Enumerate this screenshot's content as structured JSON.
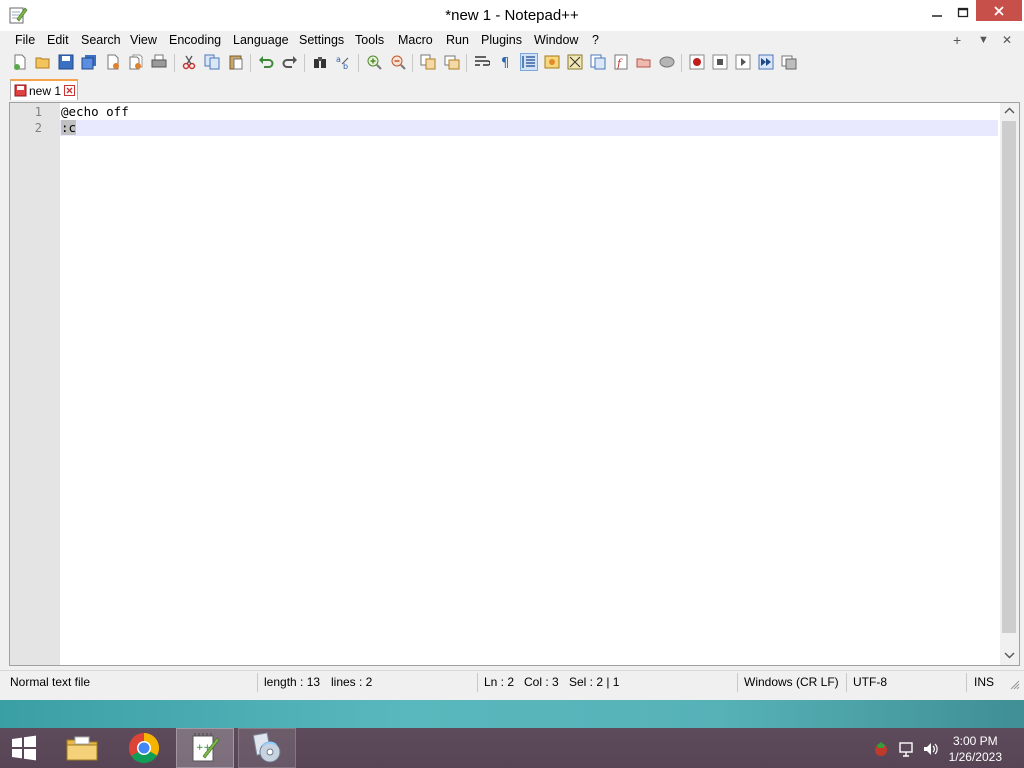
{
  "window": {
    "title": "*new 1 - Notepad++"
  },
  "menu": {
    "items": [
      {
        "id": "file",
        "label": "File"
      },
      {
        "id": "edit",
        "label": "Edit"
      },
      {
        "id": "search",
        "label": "Search"
      },
      {
        "id": "view",
        "label": "View"
      },
      {
        "id": "encoding",
        "label": "Encoding"
      },
      {
        "id": "language",
        "label": "Language"
      },
      {
        "id": "settings",
        "label": "Settings"
      },
      {
        "id": "tools",
        "label": "Tools"
      },
      {
        "id": "macro",
        "label": "Macro"
      },
      {
        "id": "run",
        "label": "Run"
      },
      {
        "id": "plugins",
        "label": "Plugins"
      },
      {
        "id": "window",
        "label": "Window"
      },
      {
        "id": "help",
        "label": "?"
      }
    ],
    "right": {
      "add": "+",
      "dropdown": "▼",
      "close": "✕"
    }
  },
  "toolbar": {
    "icons": [
      "new-file-icon",
      "open-file-icon",
      "save-icon",
      "save-all-icon",
      "close-icon",
      "close-all-icon",
      "print-icon",
      "cut-icon",
      "copy-icon",
      "paste-icon",
      "undo-icon",
      "redo-icon",
      "find-icon",
      "replace-icon",
      "zoom-in-icon",
      "zoom-out-icon",
      "sync-vertical-icon",
      "sync-horizontal-icon",
      "word-wrap-icon",
      "show-all-characters-icon",
      "indent-guide-icon",
      "user-defined-language-icon",
      "document-map-icon",
      "document-list-icon",
      "function-list-icon",
      "folder-as-workspace-icon",
      "monitoring-icon",
      "record-macro-icon",
      "stop-recording-icon",
      "playback-icon",
      "run-macro-multiple-icon",
      "save-macro-icon"
    ]
  },
  "tabs": [
    {
      "label": "new 1",
      "modified": true
    }
  ],
  "editor": {
    "lines": [
      {
        "num": "1",
        "text": "@echo off"
      },
      {
        "num": "2",
        "text": ":c"
      }
    ],
    "current_line": 2
  },
  "status": {
    "file_type": "Normal text file",
    "length": "length : 13",
    "lines": "lines : 2",
    "ln": "Ln : 2",
    "col": "Col : 3",
    "sel": "Sel : 2 | 1",
    "eol": "Windows (CR LF)",
    "encoding": "UTF-8",
    "mode": "INS"
  },
  "taskbar": {
    "apps": [
      {
        "name": "file-explorer-icon"
      },
      {
        "name": "chrome-icon"
      },
      {
        "name": "notepadpp-icon",
        "active": true
      },
      {
        "name": "disc-app-icon"
      }
    ],
    "clock": {
      "time": "3:00 PM",
      "date": "1/26/2023"
    }
  },
  "colors": {
    "accent_tab": "#f7a34b",
    "current_line": "#e8e8ff",
    "taskbar": "#5d4b5b",
    "desktop": "#59b8bd"
  }
}
